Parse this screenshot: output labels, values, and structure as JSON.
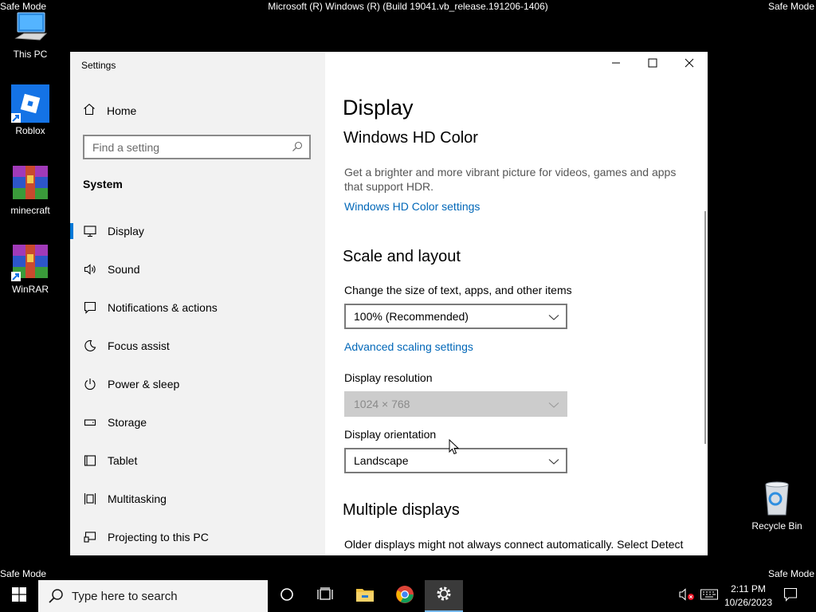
{
  "overlay": {
    "safe_mode": "Safe Mode",
    "build": "Microsoft (R) Windows (R) (Build 19041.vb_release.191206-1406)"
  },
  "desktop": {
    "icons": [
      {
        "label": "This PC",
        "icon": "this-pc-icon"
      },
      {
        "label": "Roblox",
        "icon": "roblox-icon"
      },
      {
        "label": "minecraft",
        "icon": "winrar-archive-icon"
      },
      {
        "label": "WinRAR",
        "icon": "winrar-icon"
      },
      {
        "label": "Recycle Bin",
        "icon": "recycle-bin-icon"
      }
    ]
  },
  "window": {
    "title": "Settings",
    "controls": {
      "minimize": "minimize-icon",
      "maximize": "maximize-icon",
      "close": "close-icon"
    }
  },
  "sidebar": {
    "home": "Home",
    "search_placeholder": "Find a setting",
    "category": "System",
    "items": [
      {
        "label": "Display",
        "icon": "monitor-icon",
        "selected": true
      },
      {
        "label": "Sound",
        "icon": "speaker-icon"
      },
      {
        "label": "Notifications & actions",
        "icon": "notification-icon"
      },
      {
        "label": "Focus assist",
        "icon": "moon-icon"
      },
      {
        "label": "Power & sleep",
        "icon": "power-icon"
      },
      {
        "label": "Storage",
        "icon": "storage-icon"
      },
      {
        "label": "Tablet",
        "icon": "tablet-icon"
      },
      {
        "label": "Multitasking",
        "icon": "multitasking-icon"
      },
      {
        "label": "Projecting to this PC",
        "icon": "projecting-icon"
      }
    ]
  },
  "content": {
    "page_title": "Display",
    "hdr": {
      "heading": "Windows HD Color",
      "description": "Get a brighter and more vibrant picture for videos, games and apps that support HDR.",
      "link": "Windows HD Color settings"
    },
    "scale": {
      "heading": "Scale and layout",
      "size_label": "Change the size of text, apps, and other items",
      "size_value": "100% (Recommended)",
      "advanced_link": "Advanced scaling settings",
      "resolution_label": "Display resolution",
      "resolution_value": "1024 × 768",
      "orientation_label": "Display orientation",
      "orientation_value": "Landscape"
    },
    "multiple": {
      "heading": "Multiple displays",
      "text": "Older displays might not always connect automatically. Select Detect"
    }
  },
  "taskbar": {
    "search_placeholder": "Type here to search",
    "time": "2:11 PM",
    "date": "10/26/2023"
  },
  "colors": {
    "accent": "#0078d7",
    "link": "#0067b8",
    "sidebar_bg": "#f2f2f2"
  }
}
